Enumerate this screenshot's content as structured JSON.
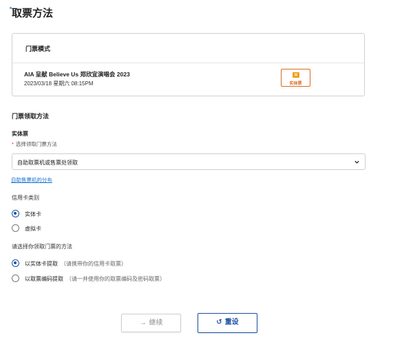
{
  "page": {
    "title": "取票方法"
  },
  "ticket_card": {
    "header": "门票模式",
    "event_name": "AIA 呈献 Believe Us 郑欣宜演唱会 2023",
    "event_datetime": "2023/03/18 星期六 08:15PM",
    "badge_label": "实体票"
  },
  "pickup": {
    "section_title": "门票领取方法",
    "sub_title": "实体票",
    "required_label": "选择领取门票方法",
    "select_value": "自助取票机或售票处领取",
    "machine_link": "自助售票机的分布"
  },
  "card_type": {
    "label": "信用卡类别",
    "options": [
      {
        "label": "实体卡",
        "checked": true
      },
      {
        "label": "虚拟卡",
        "checked": false
      }
    ]
  },
  "pickup_method": {
    "label": "请选择你领取门票的方法",
    "options": [
      {
        "label": "以实体卡提取",
        "hint": "（请携带你的信用卡取票）",
        "checked": true
      },
      {
        "label": "以取票编码提取",
        "hint": "（请一并使用你的取票编码及密码取票）",
        "checked": false
      }
    ]
  },
  "buttons": {
    "continue_label": "继续",
    "reset_label": "重设"
  },
  "colors": {
    "accent": "#1a4fa0",
    "badge": "#d9691e",
    "link": "#1a73d1",
    "required": "#d9261c"
  }
}
